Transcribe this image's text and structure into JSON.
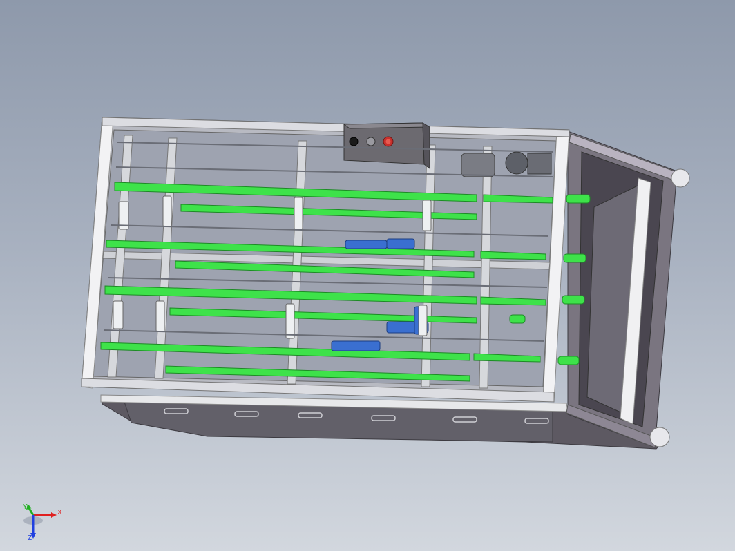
{
  "viewport": {
    "background_top": "#8e99ab",
    "background_bottom": "#d2d7de"
  },
  "model": {
    "frame_color": "#c9ccd2",
    "panel_color": "#5d5962",
    "belt_color": "#3ee24a",
    "motor_color": "#3a6fd0",
    "control_box": {
      "color": "#6c6a70",
      "buttons": [
        "black-button",
        "grey-button",
        "red-stop-button"
      ]
    }
  },
  "triad": {
    "x_label": "X",
    "y_label": "Y",
    "z_label": "Z",
    "x_color": "#e02020",
    "y_color": "#20b020",
    "z_color": "#2040e0"
  }
}
